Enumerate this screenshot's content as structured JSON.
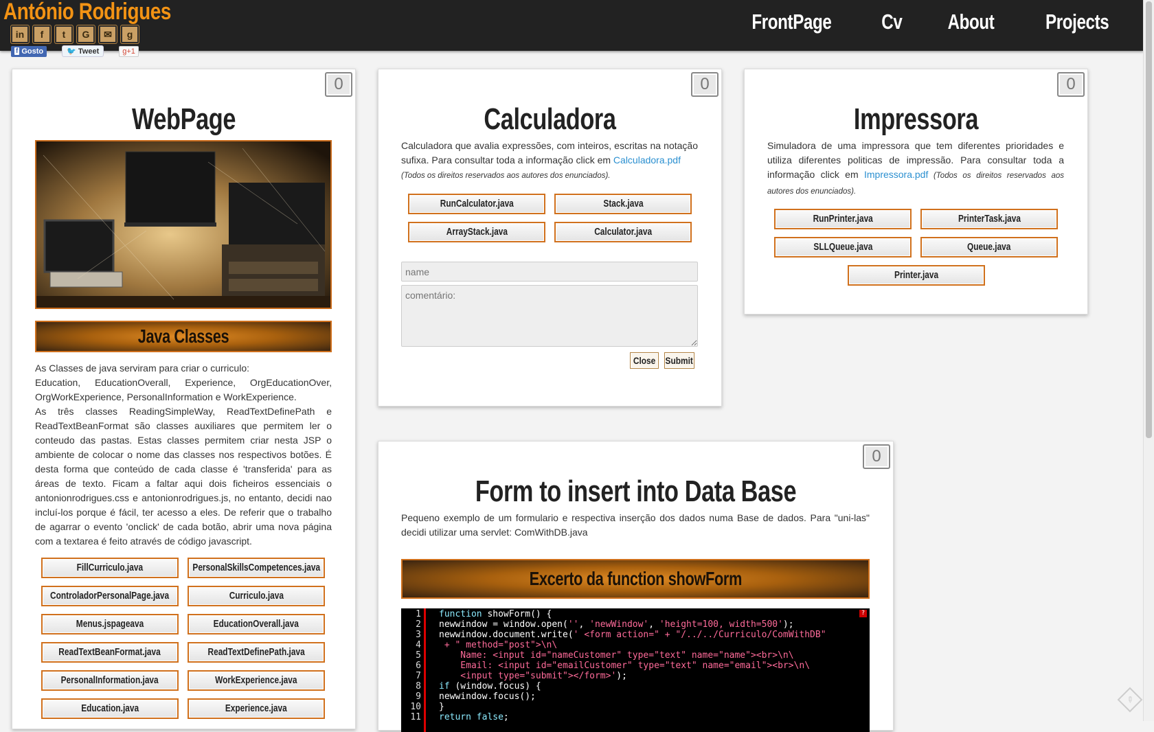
{
  "header": {
    "brand": "António Rodrigues",
    "social_icons": [
      "linkedin-icon",
      "facebook-icon",
      "twitter-icon",
      "goodreads-icon",
      "mail-icon",
      "google-icon"
    ],
    "social_glyphs": [
      "in",
      "f",
      "t",
      "G",
      "✉",
      "g"
    ],
    "share": {
      "like": "Gosto",
      "tweet": "Tweet",
      "gplus": "+1"
    },
    "nav": [
      "FrontPage",
      "Cv",
      "About",
      "Projects"
    ]
  },
  "webpage": {
    "like_count": "0",
    "title": "WebPage",
    "banner": "Java Classes",
    "intro_1": "As Classes de java serviram para criar o curriculo:",
    "intro_2": "Education, EducationOverall, Experience, OrgEducationOver, OrgWorkExperience, PersonalInformation e WorkExperience.",
    "intro_3": "As três classes ReadingSimpleWay, ReadTextDefinePath e ReadTextBeanFormat são classes auxiliares que permitem ler o conteudo das pastas. Estas classes permitem criar nesta JSP o ambiente de colocar o nome das classes nos respectivos botões. É desta forma que conteúdo de cada classe é 'transferida' para as áreas de texto. Ficam a faltar aqui dois ficheiros essenciais o antonionrodrigues.css e antonionrodrigues.js, no entanto, decidi nao incluí-los porque é fácil, ter acesso a eles. De referir que o trabalho de agarrar o evento 'onclick' de cada botão, abrir uma nova página com a textarea é feito através de código javascript.",
    "buttons": [
      "FillCurriculo.java",
      "PersonalSkillsCompetences.java",
      "ControladorPersonalPage.java",
      "Curriculo.java",
      "Menus.jspageava",
      "EducationOverall.java",
      "ReadTextBeanFormat.java",
      "ReadTextDefinePath.java",
      "PersonalInformation.java",
      "WorkExperience.java",
      "Education.java",
      "Experience.java"
    ]
  },
  "calculadora": {
    "like_count": "0",
    "title": "Calculadora",
    "desc": "Calculadora que avalia expressões, com inteiros, escritas na notação sufixa. Para consultar toda a informação click em ",
    "link": "Calculadora.pdf",
    "rights": "(Todos os direitos reservados aos autores dos enunciados).",
    "buttons": [
      "RunCalculator.java",
      "Stack.java",
      "ArrayStack.java",
      "Calculator.java"
    ],
    "name_placeholder": "name",
    "comment_placeholder": "comentário:",
    "close": "Close",
    "submit": "Submit"
  },
  "impressora": {
    "like_count": "0",
    "title": "Impressora",
    "desc": "Simuladora de uma impressora que tem diferentes prioridades e utiliza diferentes politicas de impressão. Para consultar toda a informação click em ",
    "link": "Impressora.pdf",
    "rights": " (Todos os direitos reservados aos autores dos enunciados).",
    "buttons": [
      "RunPrinter.java",
      "PrinterTask.java",
      "SLLQueue.java",
      "Queue.java",
      "Printer.java"
    ]
  },
  "form_db": {
    "like_count": "0",
    "title": "Form to insert into Data Base",
    "desc": "Pequeno exemplo de um formulario e respectiva inserção dos dados numa Base de dados. Para \"uni-las\" decidi utilizar uma servlet: ComWithDB.java",
    "banner": "Excerto da function showForm",
    "line_numbers": [
      "1",
      "2",
      "3",
      "4",
      "5",
      "6",
      "7",
      "8",
      "9",
      "10",
      "11"
    ],
    "help": "?"
  }
}
